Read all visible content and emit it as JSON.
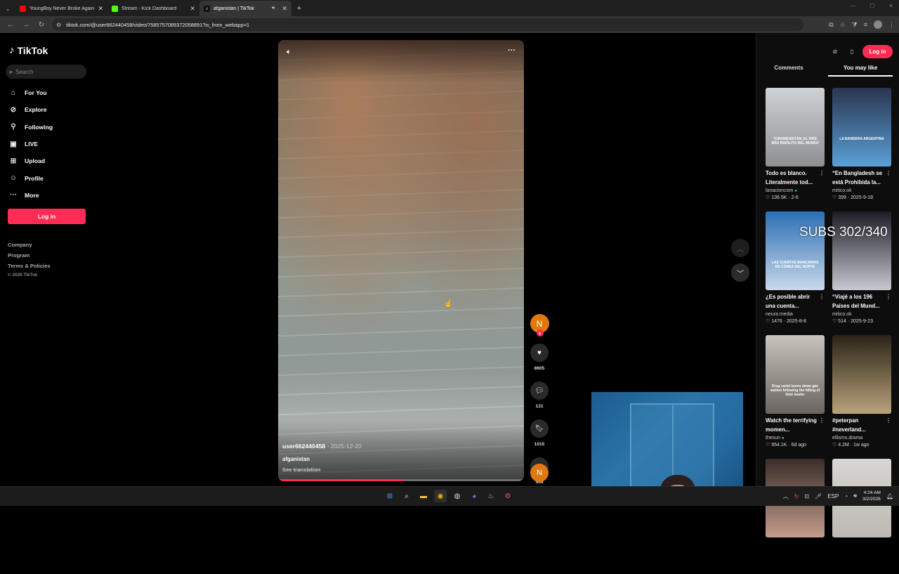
{
  "browser": {
    "tabs": [
      {
        "title": "YoungBoy Never Broke Again",
        "favicon_color": "#ff0000",
        "active": false
      },
      {
        "title": "Stream - Kick Dashboard",
        "favicon_color": "#53fc18",
        "active": false
      },
      {
        "title": "afganistan | TikTok",
        "favicon_color": "#ffffff",
        "active": true
      }
    ],
    "url": "tiktok.com/@user662440458/video/7585757085372058891?is_from_webapp=1"
  },
  "sidebar": {
    "logo_text": "TikTok",
    "search_placeholder": "Search",
    "items": [
      {
        "label": "For You",
        "icon": "home-icon"
      },
      {
        "label": "Explore",
        "icon": "compass-icon"
      },
      {
        "label": "Following",
        "icon": "user-follow-icon"
      },
      {
        "label": "LIVE",
        "icon": "live-tv-icon"
      },
      {
        "label": "Upload",
        "icon": "upload-plus-icon"
      },
      {
        "label": "Profile",
        "icon": "profile-icon"
      },
      {
        "label": "More",
        "icon": "more-dots-icon"
      }
    ],
    "login_label": "Log in",
    "footer": [
      "Company",
      "Program",
      "Terms & Policies"
    ],
    "copyright": "© 2026 TikTok"
  },
  "video": {
    "username": "user662440458",
    "date": "· 2025-12-20",
    "description": "afganistan",
    "see_translation": "See translation",
    "progress": 0.51
  },
  "actions": {
    "avatar_initial": "N",
    "likes": "8605",
    "comments": "131",
    "saves": "1015",
    "shares": "568"
  },
  "right_panel": {
    "login_label": "Log in",
    "tabs": [
      "Comments",
      "You may like"
    ],
    "active_tab": "You may like",
    "cards": [
      {
        "title": "Todo es blanco. Literalmente tod...",
        "author": "lanacioncom",
        "verified": true,
        "stats": "♡ 136.5K · 2-6",
        "overlay": "TURKMENISTÁN, EL PAÍS MÁS INSÓLITO DEL MUNDO",
        "colors": [
          "#cfd2d5",
          "#8d8f92"
        ]
      },
      {
        "title": "“En Bangladesh se está Prohibida la...",
        "author": "mitico.ok",
        "verified": false,
        "stats": "♡ 399 · 2025-9-18",
        "overlay": "LA BANDERA ARGENTINA",
        "colors": [
          "#2a3550",
          "#5aa0d8"
        ]
      },
      {
        "title": "¿Es posible abrir una cuenta...",
        "author": "neura.media",
        "verified": false,
        "stats": "♡ 1476 · 2025-8-8",
        "overlay": "LAS CUENTAS BANCARIAS EN COREA DEL NORTE",
        "colors": [
          "#2a6fb5",
          "#c9d8ea"
        ]
      },
      {
        "title": "“Viajé a los 196 Países del Mund...",
        "author": "mitico.ok",
        "verified": false,
        "stats": "♡ 514 · 2025-9-23",
        "overlay": "",
        "colors": [
          "#1c1c24",
          "#c8c8d0"
        ]
      },
      {
        "title": "Watch the terrifying momen...",
        "author": "thesun",
        "verified": true,
        "stats": "♡ 954.1K · 6d ago",
        "overlay": "Drug cartel burns down gas station following the killing of their leader",
        "colors": [
          "#c9c3bc",
          "#6a6460"
        ]
      },
      {
        "title": "#peterpan #neverland...",
        "author": "ellisms.drama",
        "verified": false,
        "stats": "♡ 4.2M · 1w ago",
        "overlay": "",
        "colors": [
          "#2a2418",
          "#b9a27a"
        ]
      },
      {
        "title": "",
        "author": "",
        "verified": false,
        "stats": "",
        "overlay": "",
        "colors": [
          "#3a2e2a",
          "#c49c8c"
        ]
      },
      {
        "title": "",
        "author": "",
        "verified": false,
        "stats": "",
        "overlay": "",
        "colors": [
          "#d8d6d2",
          "#bcb8b2"
        ]
      }
    ]
  },
  "overlay_text": "SUBS 302/340",
  "taskbar": {
    "language": "ESP",
    "time": "4:24 AM",
    "date": "3/2/2026"
  }
}
